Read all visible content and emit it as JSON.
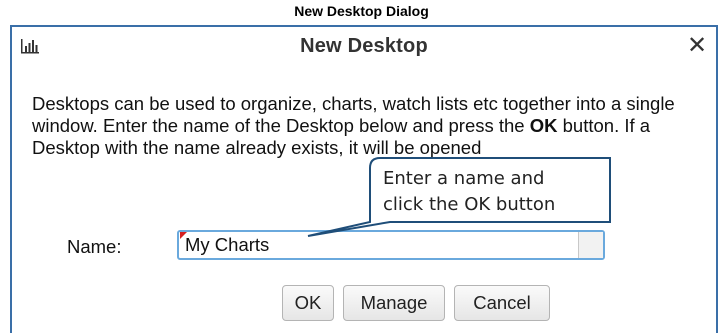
{
  "caption": "New Desktop Dialog",
  "dialog": {
    "title": "New Desktop",
    "app_icon": "bar-chart-icon",
    "close_glyph": "✕",
    "description_part1": "Desktops can be used to organize, charts, watch lists etc together into a single window.  Enter the name of the Desktop below and press the ",
    "description_bold": "OK",
    "description_part2": " button.  If a Desktop with the name already exists, it will be opened",
    "name_label": "Name:",
    "name_value": "My Charts",
    "buttons": {
      "ok": "OK",
      "manage": "Manage",
      "cancel": "Cancel"
    }
  },
  "callout": {
    "line1": "Enter a name and",
    "line2": "click the OK button"
  },
  "colors": {
    "dialog_border": "#3a6fa8",
    "input_border": "#6aa9dd",
    "input_marker": "#d42020"
  }
}
